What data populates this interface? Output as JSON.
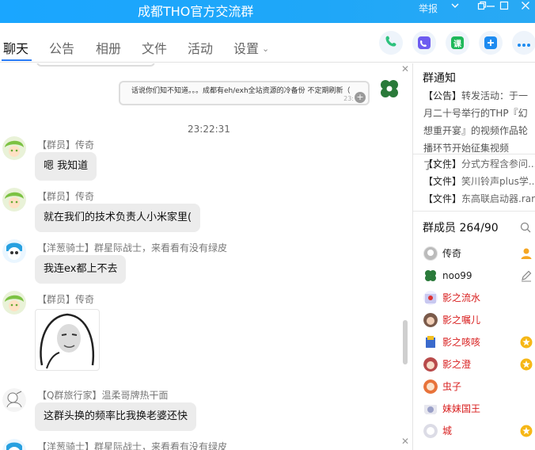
{
  "window": {
    "title": "成都THO官方交流群",
    "report_label": "举报",
    "controls": [
      "dropdown",
      "restore",
      "minimize",
      "maximize",
      "close"
    ]
  },
  "tabs": [
    {
      "label": "聊天",
      "active": true
    },
    {
      "label": "公告"
    },
    {
      "label": "相册"
    },
    {
      "label": "文件"
    },
    {
      "label": "活动"
    },
    {
      "label": "设置"
    }
  ],
  "toolbar": {
    "phone": {
      "icon": "phone-icon",
      "color": "#2ec27e"
    },
    "video": {
      "icon": "video-call-icon",
      "color": "#6d5cf0"
    },
    "course": {
      "icon": "course-icon",
      "label": "课",
      "color": "#1fb85a"
    },
    "add": {
      "icon": "add-app-icon",
      "color": "#1e8bf0"
    },
    "more": {
      "icon": "more-icon",
      "color": "#1e8bf0"
    }
  },
  "chat": {
    "quoted_message": {
      "text": "话说你们知不知道。。。成都有eh/exh全站资源的冷备份 不定期刷新（",
      "time": "23:"
    },
    "timestamp": "23:22:31",
    "messages": [
      {
        "sender": "【群员】传奇",
        "text": "嗯 我知道"
      },
      {
        "sender": "【群员】传奇",
        "text": "就在我们的技术负责人小米家里("
      },
      {
        "sender": "【洋葱骑士】群星际战士，来看看有没有绿皮",
        "text": "我连ex都上不去"
      },
      {
        "sender": "【群员】传奇",
        "text": ""
      },
      {
        "sender": "【Q群旅行家】温柔哥牌热干面",
        "text": "这群头换的频率比我换老婆还快"
      },
      {
        "sender": "【洋葱骑士】群星际战士，来看看有没有绿皮",
        "text": ""
      }
    ]
  },
  "panel": {
    "notice_title": "群通知",
    "notice_tag": "【公告】",
    "notice_text": "转发活动：于一月二十号举行的THP『幻想重开宴』的视频作品轮播环节开始征集视频了！...",
    "files": [
      {
        "tag": "【文件】",
        "name": "分式方程含参问..."
      },
      {
        "tag": "【文件】",
        "name": "笑川铃声plus学..."
      },
      {
        "tag": "【文件】",
        "name": "东高联启动器.rar"
      }
    ],
    "members_title": "群成员",
    "member_count": "264/90",
    "members": [
      {
        "name": "传奇",
        "color": "#111111",
        "role": "owner"
      },
      {
        "name": "noo99",
        "color": "#111111",
        "role": "edit"
      },
      {
        "name": "影之流水",
        "color": "#d81e1e",
        "role": ""
      },
      {
        "name": "影之嘱儿",
        "color": "#d81e1e",
        "role": ""
      },
      {
        "name": "影之咳咳",
        "color": "#d81e1e",
        "role": "star"
      },
      {
        "name": "影之澄",
        "color": "#d81e1e",
        "role": "star"
      },
      {
        "name": "虫子",
        "color": "#d81e1e",
        "role": ""
      },
      {
        "name": "妹妹国王",
        "color": "#d81e1e",
        "role": ""
      },
      {
        "name": "城",
        "color": "#d81e1e",
        "role": "star"
      }
    ]
  }
}
